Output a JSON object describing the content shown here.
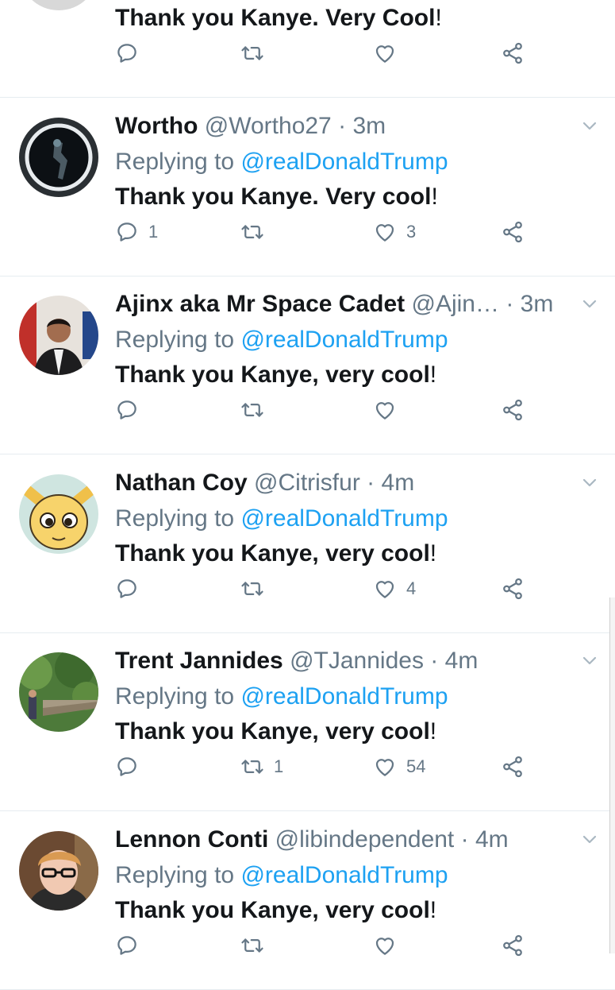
{
  "top_tweet": {
    "text": "Thank you Kanye. Very Cool",
    "punct": "!",
    "reply_count": "",
    "retweet_count": "",
    "like_count": ""
  },
  "tweets": [
    {
      "name": "Wortho",
      "handle": "@Wortho27",
      "sep": "·",
      "time": "3m",
      "replying_prefix": "Replying to",
      "replying_to": "@realDonaldTrump",
      "text": "Thank you Kanye. Very cool",
      "punct": "!",
      "reply_count": "1",
      "retweet_count": "",
      "like_count": "3"
    },
    {
      "name": "Ajinx aka Mr Space Cadet",
      "handle": "@Ajin…",
      "sep": "·",
      "time": "3m",
      "replying_prefix": "Replying to",
      "replying_to": "@realDonaldTrump",
      "text": "Thank you Kanye, very cool",
      "punct": "!",
      "reply_count": "",
      "retweet_count": "",
      "like_count": ""
    },
    {
      "name": "Nathan Coy",
      "handle": "@Citrisfur",
      "sep": "·",
      "time": "4m",
      "replying_prefix": "Replying to",
      "replying_to": "@realDonaldTrump",
      "text": "Thank you Kanye, very cool",
      "punct": "!",
      "reply_count": "",
      "retweet_count": "",
      "like_count": "4"
    },
    {
      "name": "Trent Jannides",
      "handle": "@TJannides",
      "sep": "·",
      "time": "4m",
      "replying_prefix": "Replying to",
      "replying_to": "@realDonaldTrump",
      "text": "Thank you Kanye, very cool",
      "punct": "!",
      "reply_count": "",
      "retweet_count": "1",
      "like_count": "54"
    },
    {
      "name": "Lennon Conti",
      "handle": "@libindependent",
      "sep": "·",
      "time": "4m",
      "replying_prefix": "Replying to",
      "replying_to": "@realDonaldTrump",
      "text": "Thank you Kanye, very cool",
      "punct": "!",
      "reply_count": "",
      "retweet_count": "",
      "like_count": ""
    }
  ],
  "icons": {
    "reply": "reply-icon",
    "retweet": "retweet-icon",
    "like": "heart-icon",
    "share": "share-icon",
    "caret": "chevron-down-icon"
  },
  "colors": {
    "mention": "#1da1f2",
    "muted": "#657786",
    "divider": "#e6ecf0"
  }
}
